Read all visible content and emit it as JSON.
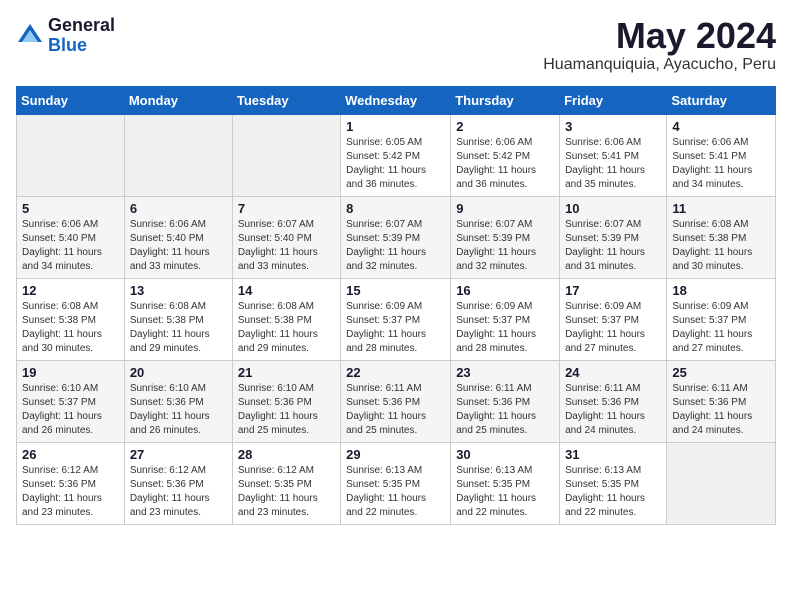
{
  "logo": {
    "general": "General",
    "blue": "Blue"
  },
  "title": {
    "month_year": "May 2024",
    "location": "Huamanquiquia, Ayacucho, Peru"
  },
  "days_of_week": [
    "Sunday",
    "Monday",
    "Tuesday",
    "Wednesday",
    "Thursday",
    "Friday",
    "Saturday"
  ],
  "weeks": [
    [
      {
        "day": "",
        "info": ""
      },
      {
        "day": "",
        "info": ""
      },
      {
        "day": "",
        "info": ""
      },
      {
        "day": "1",
        "info": "Sunrise: 6:05 AM\nSunset: 5:42 PM\nDaylight: 11 hours and 36 minutes."
      },
      {
        "day": "2",
        "info": "Sunrise: 6:06 AM\nSunset: 5:42 PM\nDaylight: 11 hours and 36 minutes."
      },
      {
        "day": "3",
        "info": "Sunrise: 6:06 AM\nSunset: 5:41 PM\nDaylight: 11 hours and 35 minutes."
      },
      {
        "day": "4",
        "info": "Sunrise: 6:06 AM\nSunset: 5:41 PM\nDaylight: 11 hours and 34 minutes."
      }
    ],
    [
      {
        "day": "5",
        "info": "Sunrise: 6:06 AM\nSunset: 5:40 PM\nDaylight: 11 hours and 34 minutes."
      },
      {
        "day": "6",
        "info": "Sunrise: 6:06 AM\nSunset: 5:40 PM\nDaylight: 11 hours and 33 minutes."
      },
      {
        "day": "7",
        "info": "Sunrise: 6:07 AM\nSunset: 5:40 PM\nDaylight: 11 hours and 33 minutes."
      },
      {
        "day": "8",
        "info": "Sunrise: 6:07 AM\nSunset: 5:39 PM\nDaylight: 11 hours and 32 minutes."
      },
      {
        "day": "9",
        "info": "Sunrise: 6:07 AM\nSunset: 5:39 PM\nDaylight: 11 hours and 32 minutes."
      },
      {
        "day": "10",
        "info": "Sunrise: 6:07 AM\nSunset: 5:39 PM\nDaylight: 11 hours and 31 minutes."
      },
      {
        "day": "11",
        "info": "Sunrise: 6:08 AM\nSunset: 5:38 PM\nDaylight: 11 hours and 30 minutes."
      }
    ],
    [
      {
        "day": "12",
        "info": "Sunrise: 6:08 AM\nSunset: 5:38 PM\nDaylight: 11 hours and 30 minutes."
      },
      {
        "day": "13",
        "info": "Sunrise: 6:08 AM\nSunset: 5:38 PM\nDaylight: 11 hours and 29 minutes."
      },
      {
        "day": "14",
        "info": "Sunrise: 6:08 AM\nSunset: 5:38 PM\nDaylight: 11 hours and 29 minutes."
      },
      {
        "day": "15",
        "info": "Sunrise: 6:09 AM\nSunset: 5:37 PM\nDaylight: 11 hours and 28 minutes."
      },
      {
        "day": "16",
        "info": "Sunrise: 6:09 AM\nSunset: 5:37 PM\nDaylight: 11 hours and 28 minutes."
      },
      {
        "day": "17",
        "info": "Sunrise: 6:09 AM\nSunset: 5:37 PM\nDaylight: 11 hours and 27 minutes."
      },
      {
        "day": "18",
        "info": "Sunrise: 6:09 AM\nSunset: 5:37 PM\nDaylight: 11 hours and 27 minutes."
      }
    ],
    [
      {
        "day": "19",
        "info": "Sunrise: 6:10 AM\nSunset: 5:37 PM\nDaylight: 11 hours and 26 minutes."
      },
      {
        "day": "20",
        "info": "Sunrise: 6:10 AM\nSunset: 5:36 PM\nDaylight: 11 hours and 26 minutes."
      },
      {
        "day": "21",
        "info": "Sunrise: 6:10 AM\nSunset: 5:36 PM\nDaylight: 11 hours and 25 minutes."
      },
      {
        "day": "22",
        "info": "Sunrise: 6:11 AM\nSunset: 5:36 PM\nDaylight: 11 hours and 25 minutes."
      },
      {
        "day": "23",
        "info": "Sunrise: 6:11 AM\nSunset: 5:36 PM\nDaylight: 11 hours and 25 minutes."
      },
      {
        "day": "24",
        "info": "Sunrise: 6:11 AM\nSunset: 5:36 PM\nDaylight: 11 hours and 24 minutes."
      },
      {
        "day": "25",
        "info": "Sunrise: 6:11 AM\nSunset: 5:36 PM\nDaylight: 11 hours and 24 minutes."
      }
    ],
    [
      {
        "day": "26",
        "info": "Sunrise: 6:12 AM\nSunset: 5:36 PM\nDaylight: 11 hours and 23 minutes."
      },
      {
        "day": "27",
        "info": "Sunrise: 6:12 AM\nSunset: 5:36 PM\nDaylight: 11 hours and 23 minutes."
      },
      {
        "day": "28",
        "info": "Sunrise: 6:12 AM\nSunset: 5:35 PM\nDaylight: 11 hours and 23 minutes."
      },
      {
        "day": "29",
        "info": "Sunrise: 6:13 AM\nSunset: 5:35 PM\nDaylight: 11 hours and 22 minutes."
      },
      {
        "day": "30",
        "info": "Sunrise: 6:13 AM\nSunset: 5:35 PM\nDaylight: 11 hours and 22 minutes."
      },
      {
        "day": "31",
        "info": "Sunrise: 6:13 AM\nSunset: 5:35 PM\nDaylight: 11 hours and 22 minutes."
      },
      {
        "day": "",
        "info": ""
      }
    ]
  ]
}
